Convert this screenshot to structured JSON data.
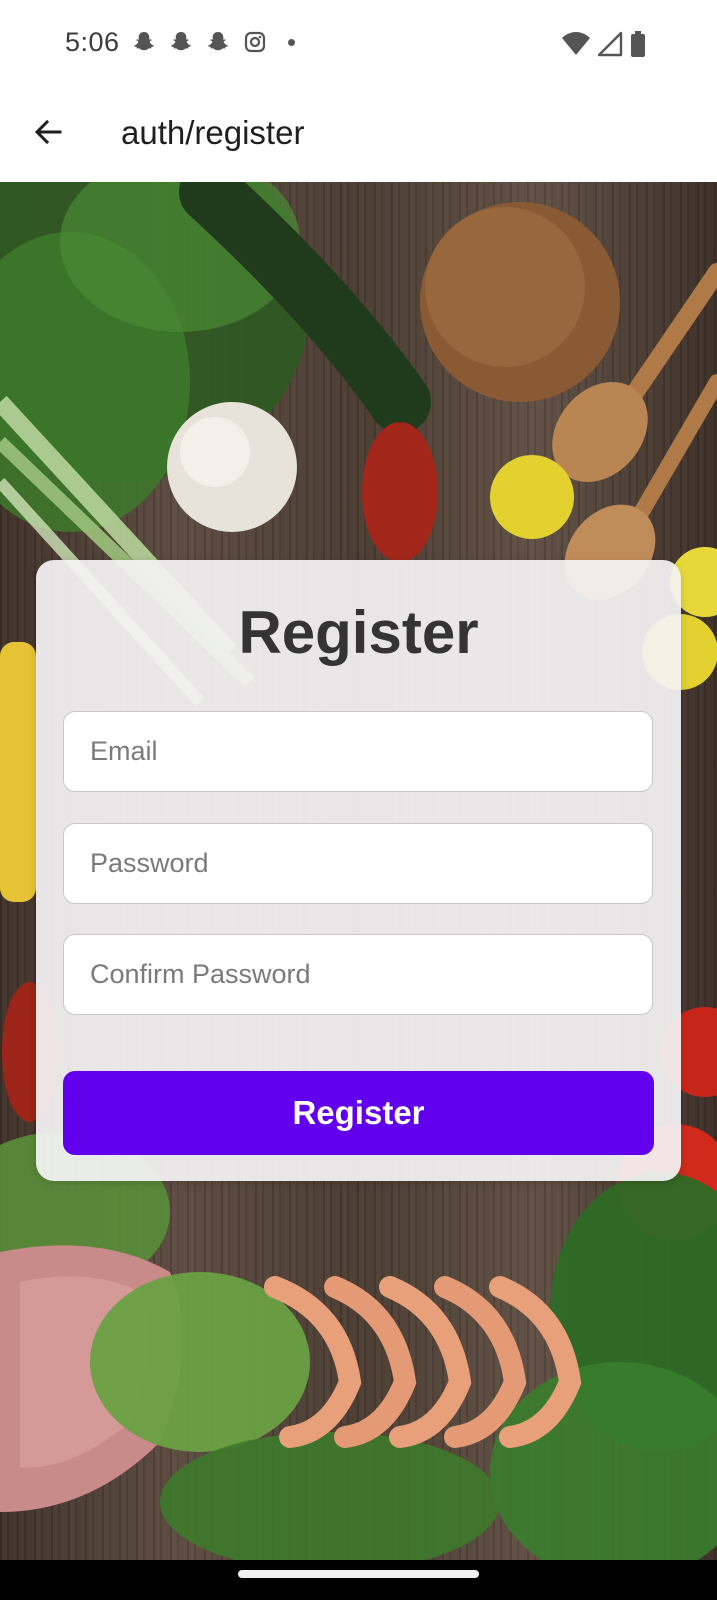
{
  "status_bar": {
    "time": "5:06",
    "notification_icons": [
      "snapchat-icon",
      "snapchat-icon",
      "snapchat-icon",
      "instagram-icon",
      "more-dot-icon"
    ],
    "system_icons": [
      "wifi-icon",
      "signal-icon",
      "battery-icon"
    ]
  },
  "app_bar": {
    "back_icon": "arrow-left-icon",
    "title": "auth/register"
  },
  "form": {
    "title": "Register",
    "email_placeholder": "Email",
    "password_placeholder": "Password",
    "confirm_password_placeholder": "Confirm Password",
    "submit_label": "Register",
    "accent_color": "#6200ee"
  }
}
